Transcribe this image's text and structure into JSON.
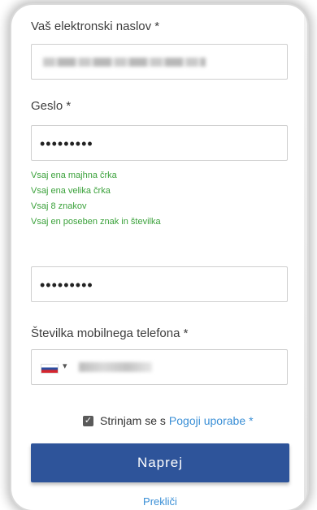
{
  "form": {
    "email_label": "Vaš elektronski naslov *",
    "password_label": "Geslo *",
    "password_value": "•••••••••",
    "password_rules": [
      "Vsaj ena majhna črka",
      "Vsaj ena velika črka",
      "Vsaj 8 znakov",
      "Vsaj en poseben znak in številka"
    ],
    "confirm_value": "•••••••••",
    "phone_label": "Številka mobilnega telefona *",
    "phone_caret": "▾"
  },
  "agreement": {
    "checked": true,
    "check_mark": "✓",
    "text": "Strinjam se s",
    "link": "Pogoji uporabe",
    "asterisk": "*"
  },
  "actions": {
    "next": "Naprej",
    "cancel": "Prekliči"
  },
  "colors": {
    "primary": "#2e549a",
    "link": "#3a8fd6",
    "rule_ok": "#3aa13a"
  }
}
